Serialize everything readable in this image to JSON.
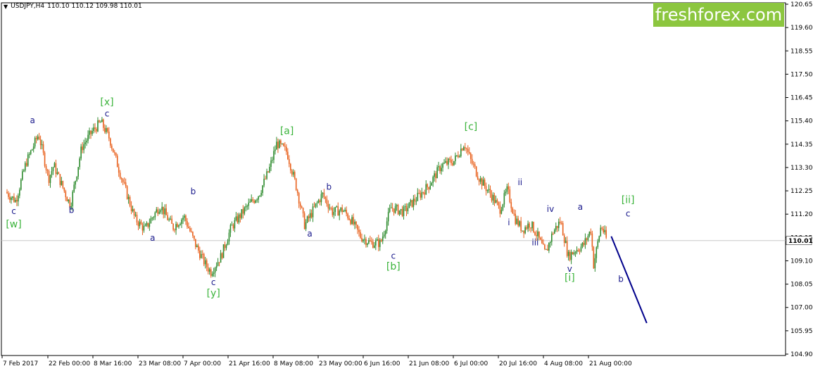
{
  "header": {
    "symbol": "USDJPY,H4",
    "ohlc": "110.10 110.12 109.98 110.01"
  },
  "brand": {
    "text": "freshforex.com"
  },
  "colors": {
    "bull": "#2e8b2e",
    "bear": "#e8601c",
    "wave_blue": "#1a1a8c",
    "wave_green": "#3cb43c",
    "price_line": "#c8c8c8",
    "forecast": "#00008b",
    "brand_bg": "#8cc63f"
  },
  "chart_data": {
    "type": "candlestick",
    "symbol": "USDJPY",
    "timeframe": "H4",
    "current_price": 110.01,
    "y_ticks": [
      "120.65",
      "119.60",
      "118.55",
      "117.50",
      "116.45",
      "115.40",
      "114.35",
      "113.30",
      "112.25",
      "111.20",
      "110.15",
      "109.10",
      "108.05",
      "107.00",
      "105.95",
      "104.90"
    ],
    "ylim": [
      104.9,
      120.65
    ],
    "x_ticks": [
      "7 Feb 2017",
      "22 Feb 00:00",
      "8 Mar 16:00",
      "23 Mar 08:00",
      "7 Apr 00:00",
      "21 Apr 16:00",
      "8 May 08:00",
      "23 May 00:00",
      "6 Jun 16:00",
      "21 Jun 08:00",
      "6 Jul 00:00",
      "20 Jul 16:00",
      "4 Aug 08:00",
      "21 Aug 00:00"
    ],
    "price_path": [
      {
        "t": 0,
        "p": 112.2
      },
      {
        "t": 0.02,
        "p": 111.8
      },
      {
        "t": 0.04,
        "p": 113.5
      },
      {
        "t": 0.065,
        "p": 114.8
      },
      {
        "t": 0.085,
        "p": 112.8
      },
      {
        "t": 0.095,
        "p": 113.4
      },
      {
        "t": 0.12,
        "p": 112.0
      },
      {
        "t": 0.128,
        "p": 111.6
      },
      {
        "t": 0.15,
        "p": 114.2
      },
      {
        "t": 0.17,
        "p": 114.9
      },
      {
        "t": 0.188,
        "p": 115.35
      },
      {
        "t": 0.205,
        "p": 114.6
      },
      {
        "t": 0.225,
        "p": 113.1
      },
      {
        "t": 0.255,
        "p": 111.0
      },
      {
        "t": 0.275,
        "p": 110.5
      },
      {
        "t": 0.285,
        "p": 110.9
      },
      {
        "t": 0.305,
        "p": 111.6
      },
      {
        "t": 0.33,
        "p": 110.6
      },
      {
        "t": 0.352,
        "p": 111.1
      },
      {
        "t": 0.375,
        "p": 109.8
      },
      {
        "t": 0.395,
        "p": 108.9
      },
      {
        "t": 0.405,
        "p": 108.6
      },
      {
        "t": 0.425,
        "p": 109.3
      },
      {
        "t": 0.445,
        "p": 110.6
      },
      {
        "t": 0.475,
        "p": 111.5
      },
      {
        "t": 0.5,
        "p": 112.1
      },
      {
        "t": 0.52,
        "p": 113.2
      },
      {
        "t": 0.535,
        "p": 114.4
      },
      {
        "t": 0.555,
        "p": 114.0
      },
      {
        "t": 0.575,
        "p": 112.3
      },
      {
        "t": 0.59,
        "p": 110.7
      },
      {
        "t": 0.61,
        "p": 111.5
      },
      {
        "t": 0.625,
        "p": 112.1
      },
      {
        "t": 0.645,
        "p": 111.3
      },
      {
        "t": 0.665,
        "p": 111.4
      },
      {
        "t": 0.68,
        "p": 111.0
      },
      {
        "t": 0.7,
        "p": 110.2
      },
      {
        "t": 0.72,
        "p": 109.9
      },
      {
        "t": 0.74,
        "p": 109.9
      },
      {
        "t": 0.76,
        "p": 111.5
      },
      {
        "t": 0.785,
        "p": 111.3
      },
      {
        "t": 0.81,
        "p": 111.9
      },
      {
        "t": 0.835,
        "p": 112.5
      },
      {
        "t": 0.86,
        "p": 113.4
      },
      {
        "t": 0.885,
        "p": 113.6
      },
      {
        "t": 0.905,
        "p": 114.4
      },
      {
        "t": 0.918,
        "p": 113.6
      },
      {
        "t": 0.935,
        "p": 112.8
      },
      {
        "t": 0.96,
        "p": 112.0
      },
      {
        "t": 0.975,
        "p": 111.4
      },
      {
        "t": 0.99,
        "p": 112.3
      },
      {
        "t": 1.005,
        "p": 111.0
      },
      {
        "t": 1.02,
        "p": 110.5
      },
      {
        "t": 1.035,
        "p": 110.8
      },
      {
        "t": 1.05,
        "p": 110.2
      },
      {
        "t": 1.065,
        "p": 109.4
      },
      {
        "t": 1.08,
        "p": 110.4
      },
      {
        "t": 1.095,
        "p": 110.9
      },
      {
        "t": 1.11,
        "p": 109.3
      },
      {
        "t": 1.125,
        "p": 109.6
      },
      {
        "t": 1.14,
        "p": 109.8
      },
      {
        "t": 1.155,
        "p": 110.5
      },
      {
        "t": 1.16,
        "p": 108.9
      },
      {
        "t": 1.175,
        "p": 110.7
      },
      {
        "t": 1.185,
        "p": 110.1
      }
    ],
    "forecast_path": [
      {
        "t": 1.195,
        "p": 110.2
      },
      {
        "t": 1.265,
        "p": 106.3
      }
    ],
    "wave_labels": [
      {
        "text": "a",
        "t": 0.053,
        "p": 115.3,
        "group": "minor"
      },
      {
        "text": "c",
        "t": 0.016,
        "p": 111.2,
        "group": "minor"
      },
      {
        "text": "[w]",
        "t": 0.016,
        "p": 110.6,
        "group": "major"
      },
      {
        "text": "b",
        "t": 0.13,
        "p": 111.25,
        "group": "minor"
      },
      {
        "text": "[x]",
        "t": 0.2,
        "p": 116.1,
        "group": "major"
      },
      {
        "text": "c",
        "t": 0.2,
        "p": 115.6,
        "group": "minor"
      },
      {
        "text": "a",
        "t": 0.29,
        "p": 110.0,
        "group": "minor"
      },
      {
        "text": "b",
        "t": 0.37,
        "p": 112.1,
        "group": "minor"
      },
      {
        "text": "c",
        "t": 0.41,
        "p": 108.0,
        "group": "minor"
      },
      {
        "text": "[y]",
        "t": 0.41,
        "p": 107.5,
        "group": "major"
      },
      {
        "text": "[a]",
        "t": 0.555,
        "p": 114.8,
        "group": "major"
      },
      {
        "text": "a",
        "t": 0.6,
        "p": 110.2,
        "group": "minor"
      },
      {
        "text": "b",
        "t": 0.638,
        "p": 112.3,
        "group": "minor"
      },
      {
        "text": "c",
        "t": 0.765,
        "p": 109.2,
        "group": "minor"
      },
      {
        "text": "[b]",
        "t": 0.765,
        "p": 108.7,
        "group": "major"
      },
      {
        "text": "[c]",
        "t": 0.918,
        "p": 115.0,
        "group": "major"
      },
      {
        "text": "ii",
        "t": 1.015,
        "p": 112.5,
        "group": "minor"
      },
      {
        "text": "i",
        "t": 0.993,
        "p": 110.7,
        "group": "minor"
      },
      {
        "text": "iv",
        "t": 1.075,
        "p": 111.3,
        "group": "minor"
      },
      {
        "text": "iii",
        "t": 1.045,
        "p": 109.8,
        "group": "minor"
      },
      {
        "text": "a",
        "t": 1.134,
        "p": 111.4,
        "group": "minor"
      },
      {
        "text": "v",
        "t": 1.113,
        "p": 108.6,
        "group": "minor"
      },
      {
        "text": "[i]",
        "t": 1.113,
        "p": 108.2,
        "group": "major"
      },
      {
        "text": "[ii]",
        "t": 1.228,
        "p": 111.7,
        "group": "major"
      },
      {
        "text": "c",
        "t": 1.228,
        "p": 111.1,
        "group": "minor"
      },
      {
        "text": "b",
        "t": 1.214,
        "p": 108.15,
        "group": "minor"
      }
    ]
  }
}
